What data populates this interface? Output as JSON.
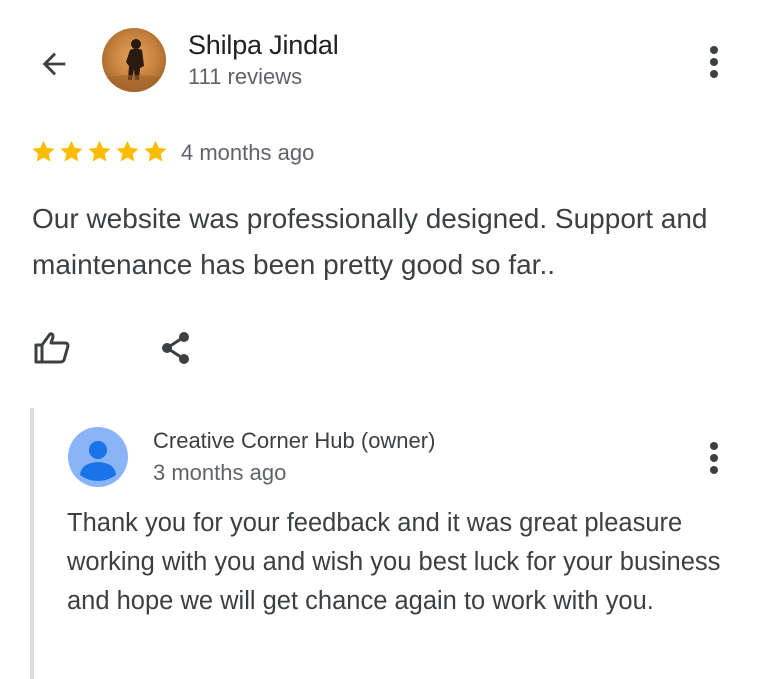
{
  "header": {
    "back_icon": "arrow-left-icon",
    "reviewer_name": "Shilpa Jindal",
    "review_count": "111 reviews",
    "more_icon": "more-vertical-icon"
  },
  "review": {
    "rating": 5,
    "rating_max": 5,
    "star_color": "#fbbc04",
    "time_ago": "4 months ago",
    "text": "Our website was professionally designed. Support and maintenance has been pretty good so far..",
    "actions": {
      "like_icon": "thumbs-up-icon",
      "share_icon": "share-icon"
    }
  },
  "owner_reply": {
    "owner_name": "Creative Corner Hub (owner)",
    "time_ago": "3 months ago",
    "avatar_icon": "default-profile-icon",
    "avatar_color": "#8ab4f8",
    "text": "Thank you for your feedback and it was great pleasure working with you and wish you best luck for your business and hope we will get chance again to work with you.",
    "more_icon": "more-vertical-icon"
  }
}
